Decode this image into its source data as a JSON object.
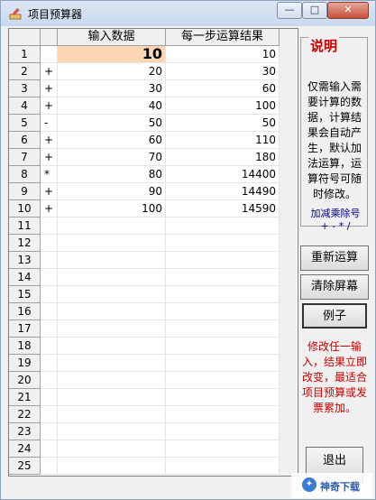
{
  "window": {
    "title": "项目预算器",
    "min_glyph": "—",
    "max_glyph": "□",
    "close_glyph": "✕"
  },
  "grid": {
    "columns": [
      "输入数据",
      "每一步运算结果"
    ],
    "rows": [
      {
        "num": "1",
        "op": "",
        "input": "10",
        "result": "10"
      },
      {
        "num": "2",
        "op": "+",
        "input": "20",
        "result": "30"
      },
      {
        "num": "3",
        "op": "+",
        "input": "30",
        "result": "60"
      },
      {
        "num": "4",
        "op": "+",
        "input": "40",
        "result": "100"
      },
      {
        "num": "5",
        "op": "-",
        "input": "50",
        "result": "50"
      },
      {
        "num": "6",
        "op": "+",
        "input": "60",
        "result": "110"
      },
      {
        "num": "7",
        "op": "+",
        "input": "70",
        "result": "180"
      },
      {
        "num": "8",
        "op": "*",
        "input": "80",
        "result": "14400"
      },
      {
        "num": "9",
        "op": "+",
        "input": "90",
        "result": "14490"
      },
      {
        "num": "10",
        "op": "+",
        "input": "100",
        "result": "14590"
      },
      {
        "num": "11",
        "op": "",
        "input": "",
        "result": ""
      },
      {
        "num": "12",
        "op": "",
        "input": "",
        "result": ""
      },
      {
        "num": "13",
        "op": "",
        "input": "",
        "result": ""
      },
      {
        "num": "14",
        "op": "",
        "input": "",
        "result": ""
      },
      {
        "num": "15",
        "op": "",
        "input": "",
        "result": ""
      },
      {
        "num": "16",
        "op": "",
        "input": "",
        "result": ""
      },
      {
        "num": "17",
        "op": "",
        "input": "",
        "result": ""
      },
      {
        "num": "18",
        "op": "",
        "input": "",
        "result": ""
      },
      {
        "num": "19",
        "op": "",
        "input": "",
        "result": ""
      },
      {
        "num": "20",
        "op": "",
        "input": "",
        "result": ""
      },
      {
        "num": "21",
        "op": "",
        "input": "",
        "result": ""
      },
      {
        "num": "22",
        "op": "",
        "input": "",
        "result": ""
      },
      {
        "num": "23",
        "op": "",
        "input": "",
        "result": ""
      },
      {
        "num": "24",
        "op": "",
        "input": "",
        "result": ""
      },
      {
        "num": "25",
        "op": "",
        "input": "",
        "result": ""
      }
    ]
  },
  "side": {
    "desc_title": "说明",
    "desc_text": "仅需输入需要计算的数据，计算结果会自动产生，默认加法运算，运算符号可随时修改。",
    "ops_title": "加减乘除号",
    "ops_symbols": "+ - * /",
    "recalc_label": "重新运算",
    "clear_label": "清除屏幕",
    "example_label": "例子",
    "note": "修改任一输入，结果立即改变，最适合项目预算或发票累加。",
    "exit_label": "退出"
  },
  "watermark": {
    "text": "神奇下载",
    "colors": {
      "brand": "#2a5caa"
    }
  }
}
